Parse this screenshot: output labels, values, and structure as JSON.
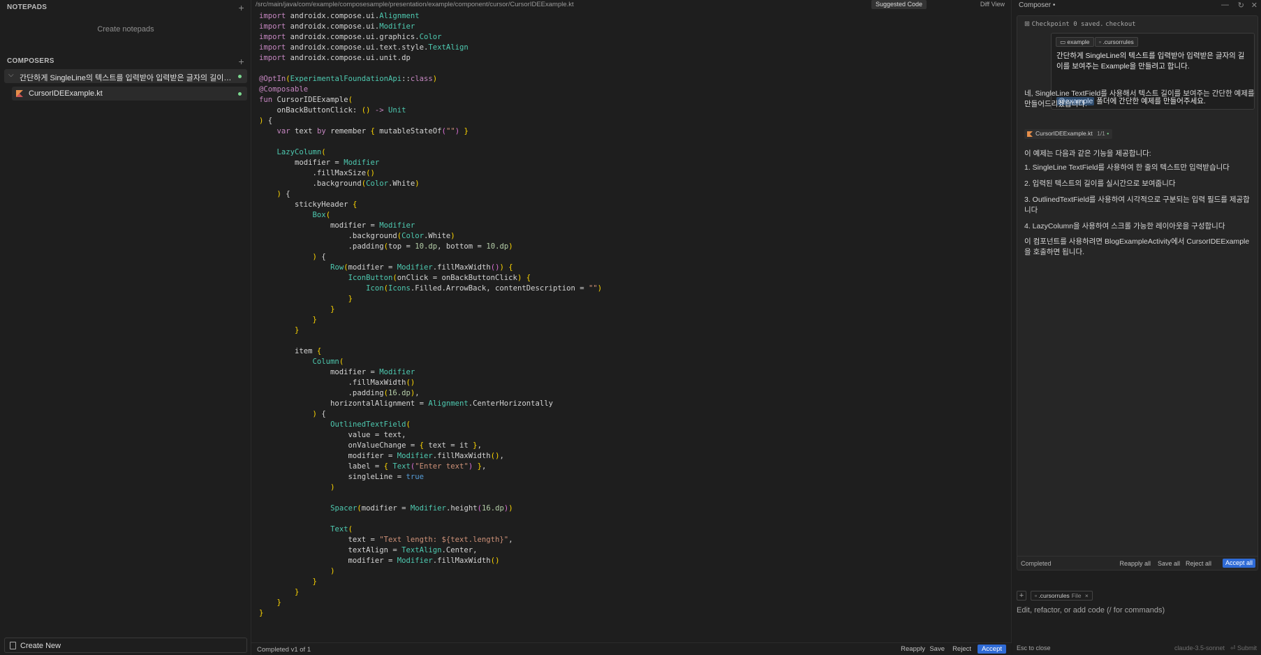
{
  "sidebar": {
    "notepads_title": "NOTEPADS",
    "add_icon": "+",
    "create_notepads": "Create notepads",
    "composers_title": "COMPOSERS",
    "composer_item": "간단하게 SingleLine의 텍스트를 입력받아 입력받은 글자의 길이를 보여주는 Example을 만들려고 합니다.",
    "file_item": "CursorIDEExample.kt",
    "create_new": "Create New"
  },
  "editor": {
    "breadcrumb": "/src/main/java/com/example/composesample/presentation/example/component/cursor/CursorIDEExample.kt",
    "tab_suggested": "Suggested Code",
    "tab_diff": "Diff View",
    "status": "Completed v1 of 1",
    "buttons": {
      "reapply": "Reapply",
      "save": "Save",
      "reject": "Reject",
      "accept": "Accept"
    }
  },
  "composer": {
    "title": "Composer •",
    "checkpoint_text": "Checkpoint 0 saved.",
    "checkpoint_link": "checkout",
    "chips": {
      "example": "example",
      "rules": ".cursorrules"
    },
    "user_message": "간단하게 SingleLine의 텍스트를 입력받아 입력받은 글자의 길이를 보여주는 Example을 만들려고 합니다.",
    "user_mention": "@example",
    "user_message_2": " 폴더에 간단한 예제를 만들어주세요.",
    "ai_intro": "네, SingleLine TextField를 사용해서 텍스트 길이를 보여주는 간단한 예제를 만들어드리겠습니다.",
    "file_chip": "CursorIDEExample.kt",
    "file_chip_count": "1/1",
    "features_intro": "이 예제는 다음과 같은 기능을 제공합니다:",
    "features": [
      "1. SingleLine TextField를 사용하여 한 줄의 텍스트만 입력받습니다",
      "2. 입력된 텍스트의 길이를 실시간으로 보여줍니다",
      "3. OutlinedTextField를 사용하여 시각적으로 구분되는 입력 필드를 제공합니다",
      "4. LazyColumn을 사용하여 스크롤 가능한 레이아웃을 구성합니다"
    ],
    "outro": "이 컴포넌트를 사용하려면 BlogExampleActivity에서 CursorIDEExample을 호출하면 됩니다.",
    "footer": {
      "status": "Completed",
      "reapply_all": "Reapply all",
      "save_all": "Save all",
      "reject_all": "Reject all",
      "accept_all": "Accept all"
    },
    "input": {
      "rules_chip": ".cursorrules",
      "rules_chip_sub": "File",
      "placeholder": "Edit, refactor, or add code (/ for commands)"
    },
    "esc_text": "Esc to close",
    "model": "claude-3.5-sonnet",
    "submit": "⏎ Submit"
  },
  "code_lines": [
    "import androidx.compose.ui.Alignment",
    "import androidx.compose.ui.Modifier",
    "import androidx.compose.ui.graphics.Color",
    "import androidx.compose.ui.text.style.TextAlign",
    "import androidx.compose.ui.unit.dp",
    "",
    "@OptIn(ExperimentalFoundationApi::class)",
    "@Composable",
    "fun CursorIDEExample(",
    "    onBackButtonClick: () -> Unit",
    ") {",
    "    var text by remember { mutableStateOf(\"\") }",
    "",
    "    LazyColumn(",
    "        modifier = Modifier",
    "            .fillMaxSize()",
    "            .background(Color.White)",
    "    ) {",
    "        stickyHeader {",
    "            Box(",
    "                modifier = Modifier",
    "                    .background(Color.White)",
    "                    .padding(top = 10.dp, bottom = 10.dp)",
    "            ) {",
    "                Row(modifier = Modifier.fillMaxWidth()) {",
    "                    IconButton(onClick = onBackButtonClick) {",
    "                        Icon(Icons.Filled.ArrowBack, contentDescription = \"\")",
    "                    }",
    "                }",
    "            }",
    "        }",
    "",
    "        item {",
    "            Column(",
    "                modifier = Modifier",
    "                    .fillMaxWidth()",
    "                    .padding(16.dp),",
    "                horizontalAlignment = Alignment.CenterHorizontally",
    "            ) {",
    "                OutlinedTextField(",
    "                    value = text,",
    "                    onValueChange = { text = it },",
    "                    modifier = Modifier.fillMaxWidth(),",
    "                    label = { Text(\"Enter text\") },",
    "                    singleLine = true",
    "                )",
    "",
    "                Spacer(modifier = Modifier.height(16.dp))",
    "",
    "                Text(",
    "                    text = \"Text length: ${text.length}\",",
    "                    textAlign = TextAlign.Center,",
    "                    modifier = Modifier.fillMaxWidth()",
    "                )",
    "            }",
    "        }",
    "    }",
    "}"
  ],
  "colors": {
    "accent": "#2f6bd6",
    "status_dot": "#7bd88f"
  },
  "icons": [
    "plus-icon",
    "chevron-down-icon",
    "kotlin-file-icon",
    "new-file-icon",
    "minimize-icon",
    "refresh-icon",
    "close-icon"
  ]
}
